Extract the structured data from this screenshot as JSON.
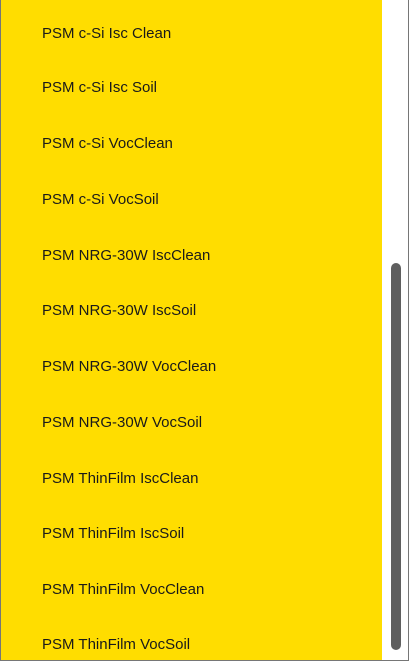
{
  "dropdown": {
    "items": [
      "PSM c-Si Isc Clean",
      "PSM c-Si Isc Soil",
      "PSM c-Si VocClean",
      "PSM c-Si VocSoil",
      "PSM NRG-30W IscClean",
      "PSM NRG-30W IscSoil",
      "PSM NRG-30W VocClean",
      "PSM NRG-30W VocSoil",
      "PSM ThinFilm IscClean",
      "PSM ThinFilm IscSoil",
      "PSM ThinFilm VocClean",
      "PSM ThinFilm VocSoil"
    ]
  },
  "colors": {
    "list_background": "#ffdd00",
    "scrollbar_thumb": "#5f5f5f"
  }
}
